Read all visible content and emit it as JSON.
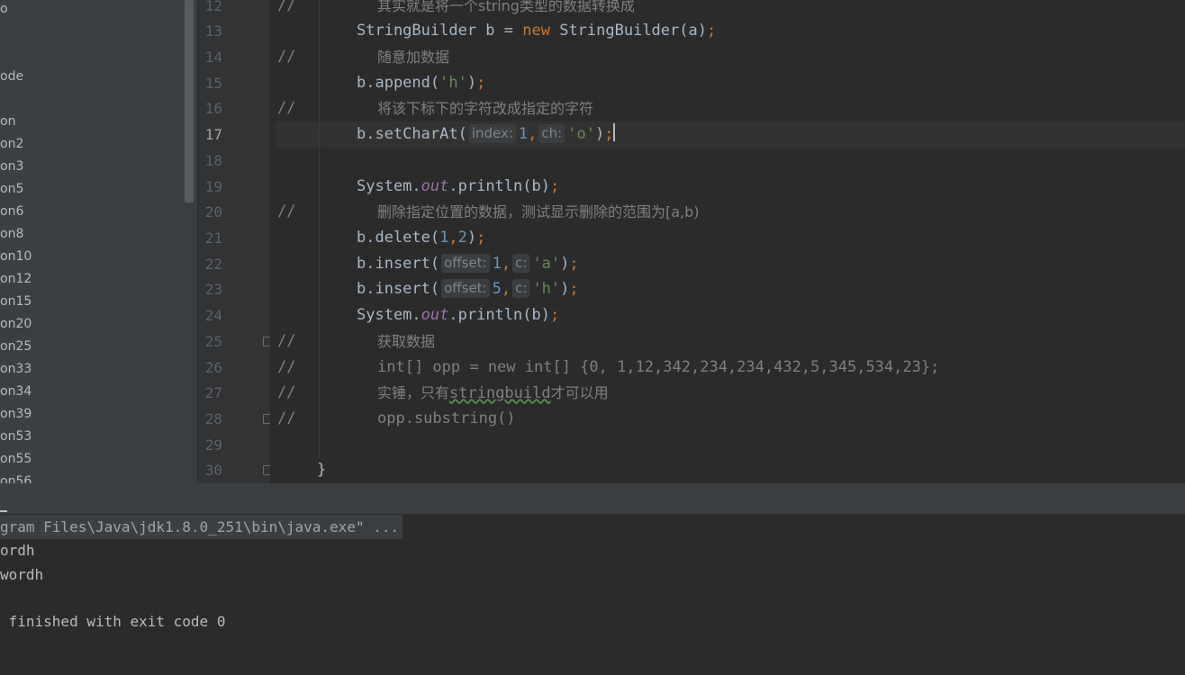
{
  "project_tree": {
    "items": [
      "o",
      "",
      "ode",
      "",
      "on",
      "on2",
      "on3",
      "on5",
      "on6",
      "on8",
      "on10",
      "on12",
      "on15",
      "on20",
      "on25",
      "on33",
      "on34",
      "on39",
      "on53",
      "on55",
      "on56"
    ]
  },
  "gutter": {
    "lines": [
      "12",
      "13",
      "14",
      "15",
      "16",
      "17",
      "18",
      "19",
      "20",
      "21",
      "22",
      "23",
      "24",
      "25",
      "26",
      "27",
      "28",
      "29",
      "30"
    ],
    "active_line": "17"
  },
  "code": {
    "l12_comment": "//",
    "l12_text": "其实就是将一个string类型的数据转换成",
    "l13": {
      "type": "StringBuilder",
      "var": " b = ",
      "new": "new",
      "ctor": " StringBuilder(a)",
      "semi": ";"
    },
    "l14_comment": "//",
    "l14_text": "随意加数据",
    "l15": {
      "call": "b.append(",
      "arg": "'h'",
      "close": ")",
      "semi": ";"
    },
    "l16_comment": "//",
    "l16_text": "将该下标下的字符改成指定的字符",
    "l17": {
      "call": "b.setCharAt(",
      "hint1": "index:",
      "arg1": "1",
      "comma": ",",
      "hint2": "ch:",
      "arg2": "'o'",
      "close": ")",
      "semi": ";"
    },
    "l19": {
      "sys": "System.",
      "out": "out",
      "call": ".println(b)",
      "semi": ";"
    },
    "l20_comment": "//",
    "l20_text": "删除指定位置的数据，测试显示删除的范围为[a,b)",
    "l21": {
      "call": "b.delete(",
      "arg1": "1",
      "comma": ",",
      "arg2": "2",
      "close": ")",
      "semi": ";"
    },
    "l22": {
      "call": "b.insert(",
      "hint1": "offset:",
      "arg1": "1",
      "comma": ",",
      "hint2": "c:",
      "arg2": "'a'",
      "close": ")",
      "semi": ";"
    },
    "l23": {
      "call": "b.insert(",
      "hint1": "offset:",
      "arg1": "5",
      "comma": ",",
      "hint2": "c:",
      "arg2": "'h'",
      "close": ")",
      "semi": ";"
    },
    "l24": {
      "sys": "System.",
      "out": "out",
      "call": ".println(b)",
      "semi": ";"
    },
    "l25_comment": "//",
    "l25_text": "获取数据",
    "l26_comment": "//",
    "l26_text": "int[] opp = new int[] {0, 1,12,342,234,234,432,5,345,534,23};",
    "l27_comment": "//",
    "l27_pre": "实锤，只有",
    "l27_word": "stringbuild",
    "l27_post": "才可以用",
    "l28_comment": "//",
    "l28_text": "opp.substring()",
    "l30_brace": "}"
  },
  "console": {
    "command": "gram Files\\Java\\jdk1.8.0_251\\bin\\java.exe\" ...",
    "out1": "ordh",
    "out2": "wordh",
    "exit": " finished with exit code 0"
  }
}
